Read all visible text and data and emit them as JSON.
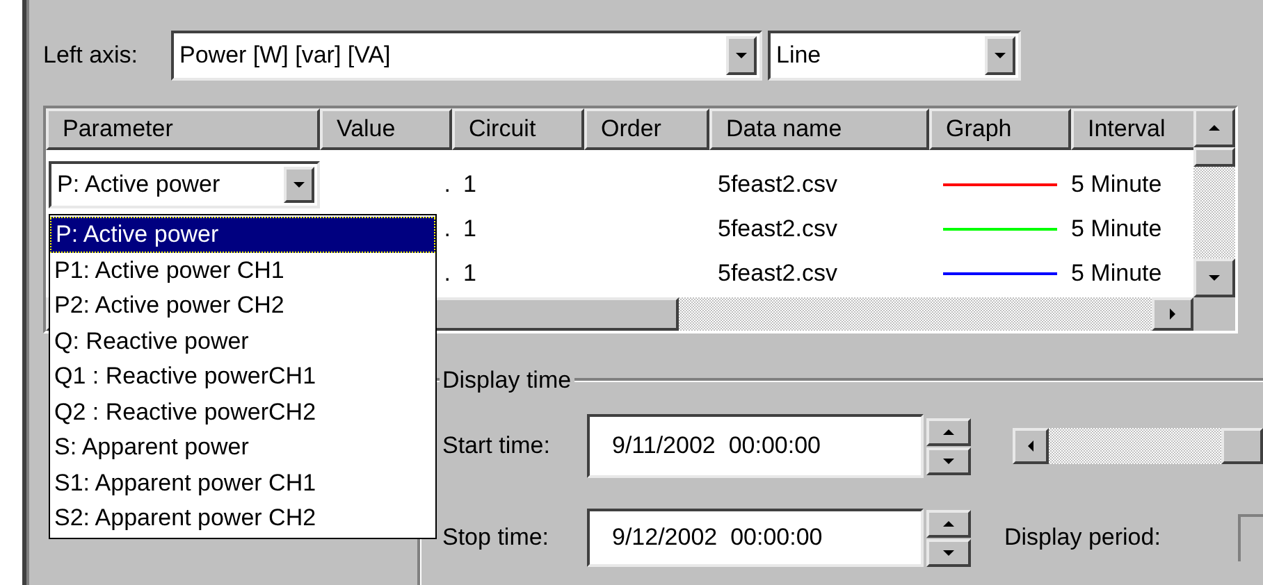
{
  "left_axis": {
    "label": "Left axis:",
    "value": "Power [W] [var] [VA]"
  },
  "chart_style": {
    "value": "Line"
  },
  "table": {
    "columns": [
      "Parameter",
      "Value",
      "Circuit",
      "Order",
      "Data name",
      "Graph",
      "Interval"
    ],
    "rows": [
      {
        "value": ".",
        "circuit": "1",
        "data_name": "5feast2.csv",
        "color": "#ff0000",
        "interval": "5 Minute"
      },
      {
        "value": ".",
        "circuit": "1",
        "data_name": "5feast2.csv",
        "color": "#00ff00",
        "interval": "5 Minute"
      },
      {
        "value": ".",
        "circuit": "1",
        "data_name": "5feast2.csv",
        "color": "#0000ff",
        "interval": "5 Minute"
      }
    ]
  },
  "parameter_dropdown": {
    "value": "P: Active power",
    "options": [
      {
        "label": "P: Active power",
        "selected": true
      },
      {
        "label": "P1: Active power CH1",
        "selected": false
      },
      {
        "label": "P2: Active power CH2",
        "selected": false
      },
      {
        "label": "Q: Reactive power",
        "selected": false
      },
      {
        "label": "Q1 : Reactive powerCH1",
        "selected": false
      },
      {
        "label": "Q2 : Reactive powerCH2",
        "selected": false
      },
      {
        "label": "S: Apparent power",
        "selected": false
      },
      {
        "label": "S1: Apparent power CH1",
        "selected": false
      },
      {
        "label": "S2: Apparent power CH2",
        "selected": false
      }
    ]
  },
  "display_time": {
    "title": "Display time",
    "start_label": "Start time:",
    "start_value": "9/11/2002  00:00:00",
    "stop_label": "Stop time:",
    "stop_value": "9/12/2002  00:00:00",
    "period_label": "Display period:",
    "slider": {
      "level": 1
    }
  }
}
